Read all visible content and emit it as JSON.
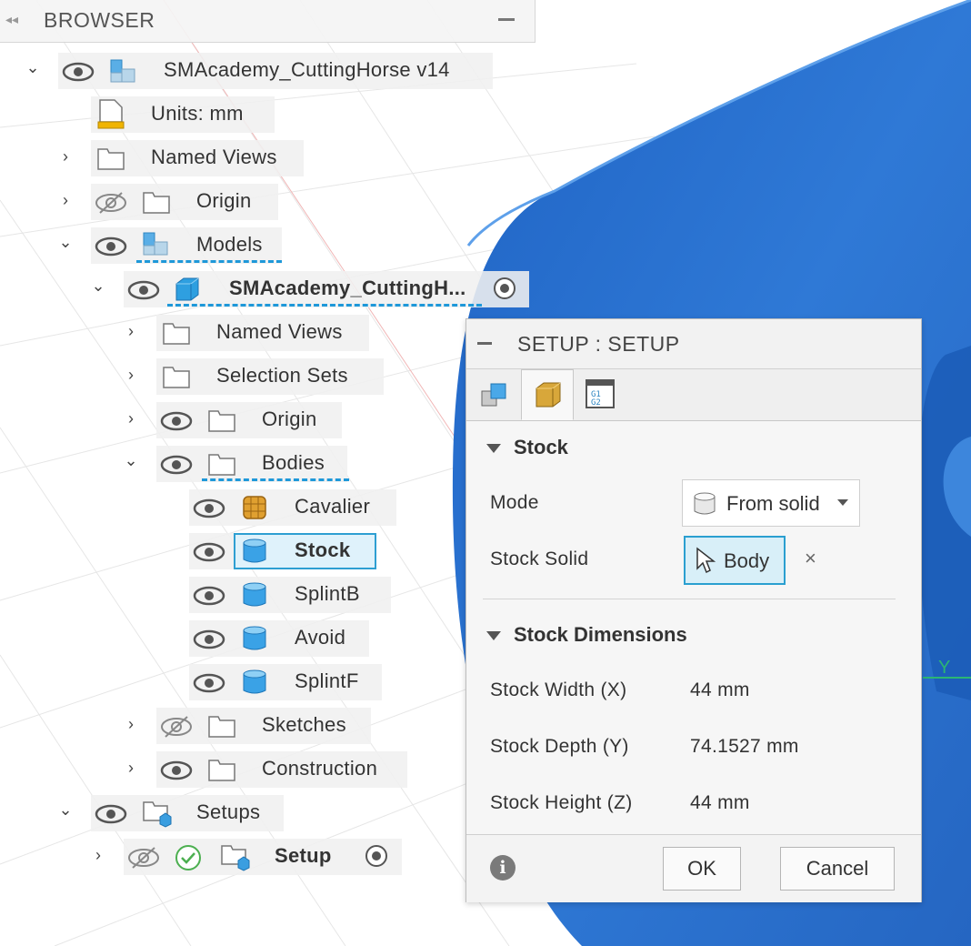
{
  "browser": {
    "title": "BROWSER",
    "items": [
      {
        "label": "SMAcademy_CuttingHorse v14"
      },
      {
        "label": "Units: mm"
      },
      {
        "label": "Named Views"
      },
      {
        "label": "Origin"
      },
      {
        "label": "Models"
      },
      {
        "label": "SMAcademy_CuttingH..."
      },
      {
        "label": "Named Views"
      },
      {
        "label": "Selection Sets"
      },
      {
        "label": "Origin"
      },
      {
        "label": "Bodies"
      },
      {
        "label": "Cavalier"
      },
      {
        "label": "Stock"
      },
      {
        "label": "SplintB"
      },
      {
        "label": "Avoid"
      },
      {
        "label": "SplintF"
      },
      {
        "label": "Sketches"
      },
      {
        "label": "Construction"
      },
      {
        "label": "Setups"
      },
      {
        "label": "Setup"
      }
    ]
  },
  "dialog": {
    "title": "SETUP : SETUP",
    "stock_section": "Stock",
    "mode_label": "Mode",
    "mode_value": "From solid",
    "stock_solid_label": "Stock Solid",
    "stock_solid_value": "Body",
    "clear_symbol": "×",
    "dimensions_section": "Stock Dimensions",
    "width_label": "Stock Width (X)",
    "width_value": "44 mm",
    "depth_label": "Stock Depth (Y)",
    "depth_value": "74.1527 mm",
    "height_label": "Stock Height (Z)",
    "height_value": "44 mm",
    "ok_label": "OK",
    "cancel_label": "Cancel",
    "info_symbol": "i"
  },
  "viewport": {
    "axis_label": "Y",
    "model_color": "#2a6fc9"
  }
}
